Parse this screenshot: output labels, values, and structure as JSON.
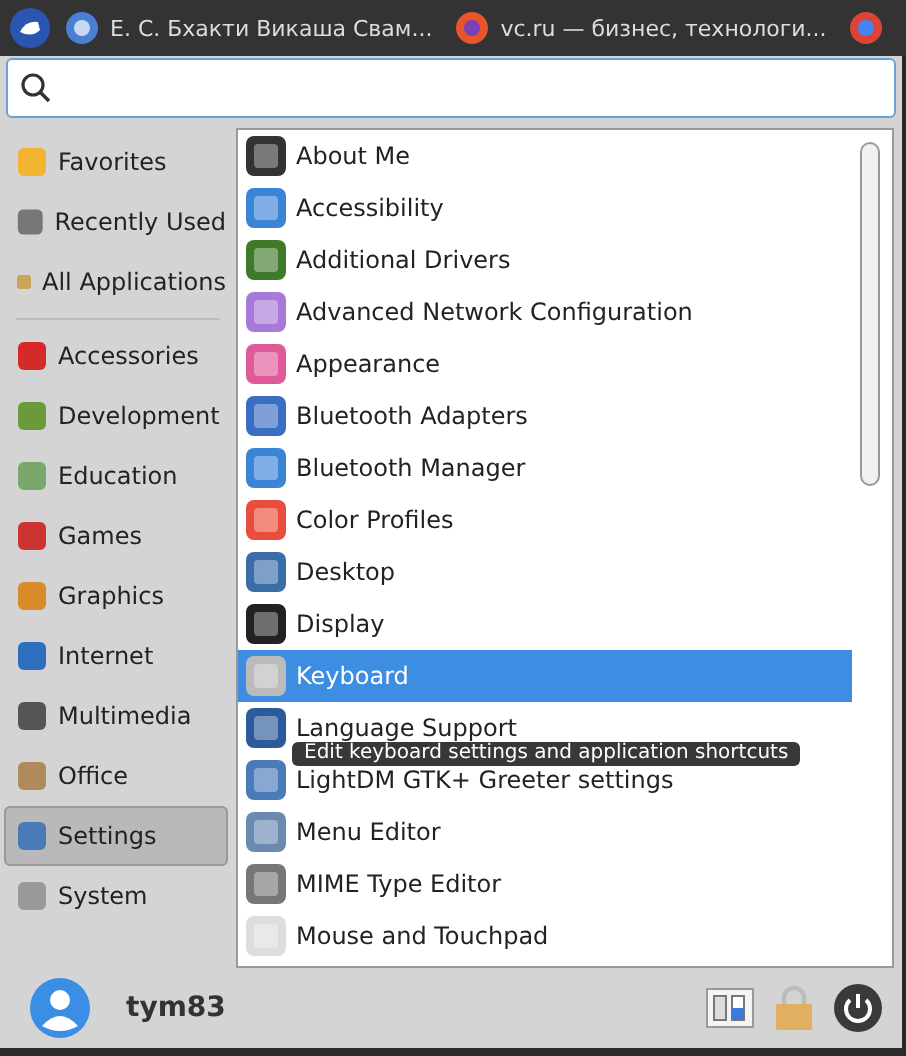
{
  "taskbar": {
    "tasks": [
      {
        "kind": "chromium",
        "label": "Е. С. Бхакти Викаша Свам..."
      },
      {
        "kind": "firefox",
        "label": "vc.ru — бизнес, технологи..."
      },
      {
        "kind": "chrome"
      }
    ]
  },
  "sidebar": {
    "items": [
      {
        "label": "Favorites",
        "selected": false,
        "separator_after": false
      },
      {
        "label": "Recently Used",
        "selected": false,
        "separator_after": false
      },
      {
        "label": "All Applications",
        "selected": false,
        "separator_after": true
      },
      {
        "label": "Accessories",
        "selected": false,
        "separator_after": false
      },
      {
        "label": "Development",
        "selected": false,
        "separator_after": false
      },
      {
        "label": "Education",
        "selected": false,
        "separator_after": false
      },
      {
        "label": "Games",
        "selected": false,
        "separator_after": false
      },
      {
        "label": "Graphics",
        "selected": false,
        "separator_after": false
      },
      {
        "label": "Internet",
        "selected": false,
        "separator_after": false
      },
      {
        "label": "Multimedia",
        "selected": false,
        "separator_after": false
      },
      {
        "label": "Office",
        "selected": false,
        "separator_after": false
      },
      {
        "label": "Settings",
        "selected": true,
        "separator_after": false
      },
      {
        "label": "System",
        "selected": false,
        "separator_after": false
      }
    ]
  },
  "apps": {
    "items": [
      {
        "label": "About Me",
        "selected": false
      },
      {
        "label": "Accessibility",
        "selected": false
      },
      {
        "label": "Additional Drivers",
        "selected": false
      },
      {
        "label": "Advanced Network Configuration",
        "selected": false
      },
      {
        "label": "Appearance",
        "selected": false
      },
      {
        "label": "Bluetooth Adapters",
        "selected": false
      },
      {
        "label": "Bluetooth Manager",
        "selected": false
      },
      {
        "label": "Color Profiles",
        "selected": false
      },
      {
        "label": "Desktop",
        "selected": false
      },
      {
        "label": "Display",
        "selected": false
      },
      {
        "label": "Keyboard",
        "selected": true
      },
      {
        "label": "Language Support",
        "selected": false
      },
      {
        "label": "LightDM GTK+ Greeter settings",
        "selected": false
      },
      {
        "label": "Menu Editor",
        "selected": false
      },
      {
        "label": "MIME Type Editor",
        "selected": false
      },
      {
        "label": "Mouse and Touchpad",
        "selected": false
      }
    ]
  },
  "tooltip": {
    "text": "Edit keyboard settings and application shortcuts"
  },
  "user": {
    "name": "tym83"
  }
}
